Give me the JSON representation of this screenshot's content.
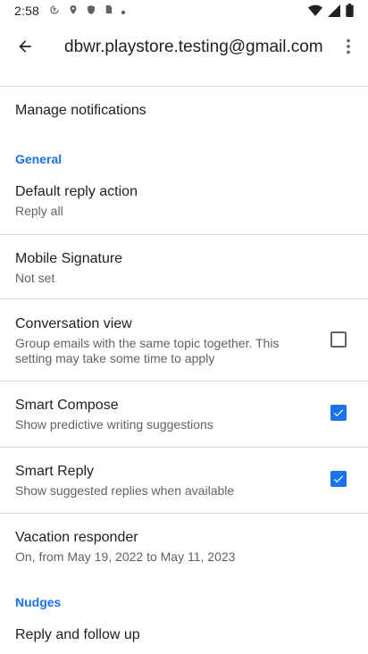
{
  "status": {
    "time": "2:58"
  },
  "appbar": {
    "title": "dbwr.playstore.testing@gmail.com"
  },
  "list": {
    "manage_notifications": "Manage notifications",
    "general_header": "General",
    "default_reply": {
      "title": "Default reply action",
      "value": "Reply all"
    },
    "mobile_signature": {
      "title": "Mobile Signature",
      "value": "Not set"
    },
    "conversation_view": {
      "title": "Conversation view",
      "summary_line1": "Group emails with the same topic together. This",
      "summary_line2": "setting may take some time to apply",
      "checked": false
    },
    "smart_compose": {
      "title": "Smart Compose",
      "summary": "Show predictive writing suggestions",
      "checked": true
    },
    "smart_reply": {
      "title": "Smart Reply",
      "summary": "Show suggested replies when available",
      "checked": true
    },
    "vacation_responder": {
      "title": "Vacation responder",
      "summary": "On, from May 19, 2022 to May 11, 2023"
    },
    "nudges_header": "Nudges",
    "reply_follow_up": "Reply and follow up"
  },
  "colors": {
    "accent": "#1a73e8",
    "text_primary": "#202124",
    "text_secondary": "#5f6368",
    "divider": "#dadce0"
  },
  "icons": [
    "back-arrow-icon",
    "overflow-menu-icon",
    "wifi-icon",
    "cell-signal-icon",
    "battery-icon",
    "gmail-notification-icon",
    "location-icon",
    "play-protect-icon",
    "sd-card-icon",
    "dot-icon"
  ]
}
